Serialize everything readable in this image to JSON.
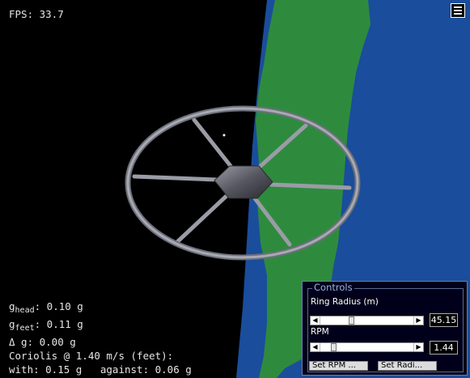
{
  "hud": {
    "fps_text": "FPS: 33.7",
    "g_head_sym": "g",
    "g_head_sub": "head",
    "g_head_val": ": 0.10 g",
    "g_feet_sym": "g",
    "g_feet_sub": "feet",
    "g_feet_val": ": 0.11 g",
    "delta_g": "Δ g: 0.00 g",
    "coriolis": "Coriolis @ 1.40 m/s (feet):",
    "with_against": "with: 0.15 g   against: 0.06 g"
  },
  "menu": {
    "icon": "hamburger-icon"
  },
  "controls": {
    "legend": "Controls",
    "ring_radius_label": "Ring Radius (m)",
    "ring_radius_value": "45.15",
    "ring_radius_fraction": 0.33,
    "rpm_label": "RPM",
    "rpm_value": "1.44",
    "rpm_fraction": 0.13,
    "set_rpm_button": "Set RPM ...",
    "set_radius_button": "Set Radi..."
  },
  "colors": {
    "space": "#000000",
    "ocean": "#1a4d9c",
    "land": "#2e8b3e",
    "ring": "#8a8d99",
    "hub": "#4e4f58"
  }
}
